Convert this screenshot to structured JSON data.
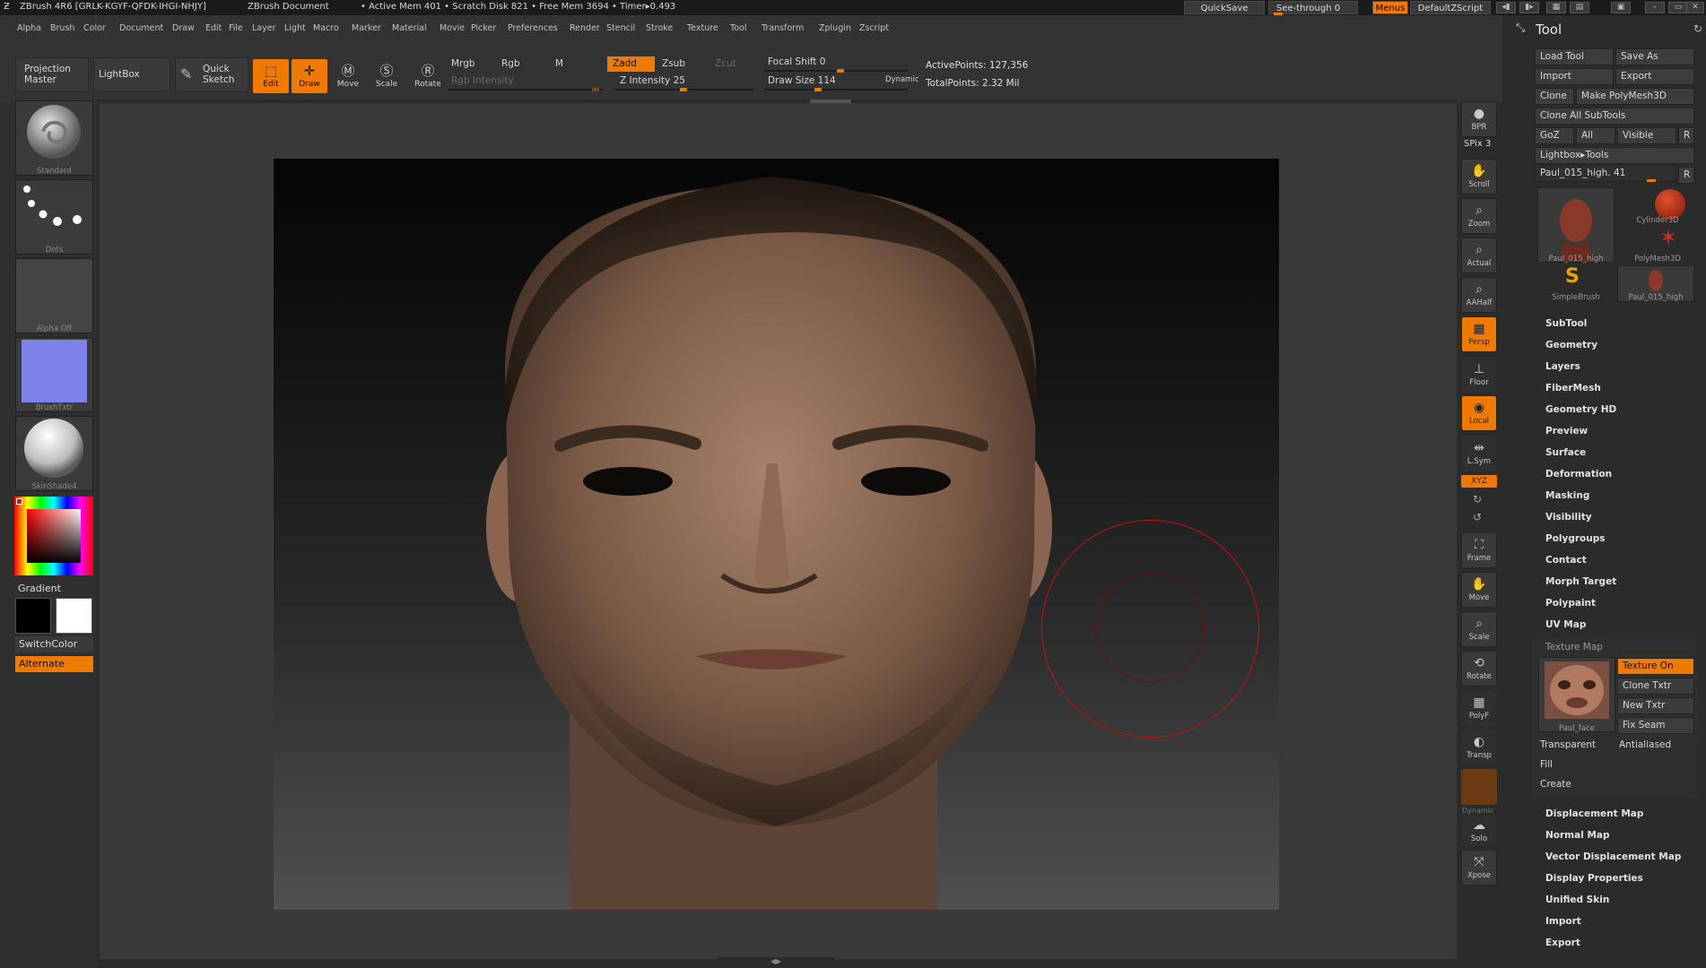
{
  "titlebar": {
    "app_title": "ZBrush 4R6 [GRLK-KGYF-QFDK-IHGI-NHJY]",
    "document": "ZBrush Document",
    "status": "• Active Mem 401 • Scratch Disk 821 • Free Mem 3694 • Timer▸0.493",
    "quicksave": "QuickSave",
    "see_through": "See-through  0",
    "menus": "Menus",
    "default_zscript": "DefaultZScript"
  },
  "menubar": [
    "Alpha",
    "Brush",
    "Color",
    "Document",
    "Draw",
    "Edit",
    "File",
    "Layer",
    "Light",
    "Macro",
    "Marker",
    "Material",
    "Movie",
    "Picker",
    "Preferences",
    "Render",
    "Stencil",
    "Stroke",
    "Texture",
    "Tool",
    "Transform",
    "Zplugin",
    "Zscript"
  ],
  "shelf": {
    "projection_master": "Projection Master",
    "lightbox": "LightBox",
    "quick_sketch": "Quick Sketch",
    "tools": [
      {
        "label": "Edit",
        "icon": "edit-icon",
        "active": true
      },
      {
        "label": "Draw",
        "icon": "draw-icon",
        "active": true
      },
      {
        "label": "Move",
        "icon": "move-icon",
        "active": false
      },
      {
        "label": "Scale",
        "icon": "scale-icon",
        "active": false
      },
      {
        "label": "Rotate",
        "icon": "rotate-icon",
        "active": false
      }
    ],
    "mrgb": "Mrgb",
    "rgb": "Rgb",
    "m": "M",
    "rgb_intensity": "Rgb Intensity",
    "zadd": "Zadd",
    "zsub": "Zsub",
    "zcut": "Zcut",
    "z_intensity": "Z Intensity 25",
    "focal_shift": "Focal Shift 0",
    "draw_size": "Draw Size 114",
    "dynamic": "Dynamic",
    "active_points": "ActivePoints: 127,356",
    "total_points": "TotalPoints: 2.32 Mil"
  },
  "lefttray": {
    "brush": "Standard",
    "stroke": "Dots",
    "alpha": "Alpha Off",
    "texture": "BrushTxtr",
    "material": "SkinShade4",
    "gradient": "Gradient",
    "switch_color": "SwitchColor",
    "alternate": "Alternate"
  },
  "righttool": [
    {
      "label": "BPR",
      "icon": "bpr-icon",
      "orange": false
    },
    {
      "label": "Scroll",
      "icon": "scroll-icon",
      "orange": false
    },
    {
      "label": "Zoom",
      "icon": "zoom-icon",
      "orange": false
    },
    {
      "label": "Actual",
      "icon": "actual-icon",
      "orange": false
    },
    {
      "label": "AAHalf",
      "icon": "aahalf-icon",
      "orange": false
    },
    {
      "label": "Persp",
      "icon": "persp-icon",
      "orange": true
    },
    {
      "label": "Floor",
      "icon": "floor-icon",
      "orange": false
    },
    {
      "label": "Local",
      "icon": "local-icon",
      "orange": true
    },
    {
      "label": "L.Sym",
      "icon": "lsym-icon",
      "orange": false
    },
    {
      "label": "Frame",
      "icon": "frame-icon",
      "orange": false
    },
    {
      "label": "Move",
      "icon": "move-icon",
      "orange": false
    },
    {
      "label": "Scale",
      "icon": "scale-icon",
      "orange": false
    },
    {
      "label": "Rotate",
      "icon": "rotate-icon",
      "orange": false
    },
    {
      "label": "PolyF",
      "icon": "polyf-icon",
      "orange": false
    },
    {
      "label": "Transp",
      "icon": "transp-icon",
      "orange": false
    },
    {
      "label": "Solo",
      "icon": "solo-icon",
      "orange": false
    },
    {
      "label": "Xpose",
      "icon": "xpose-icon",
      "orange": false
    }
  ],
  "righttool_misc": {
    "spix": "SPix 3",
    "xyz": "XYZ",
    "dynamic": "Dynamic"
  },
  "palette": {
    "title": "Tool",
    "load_tool": "Load Tool",
    "save_as": "Save As",
    "import": "Import",
    "export": "Export",
    "clone": "Clone",
    "make_polymesh": "Make PolyMesh3D",
    "clone_all": "Clone All SubTools",
    "goz": "GoZ",
    "all": "All",
    "visible": "Visible",
    "r": "R",
    "lightbox_tools": "Lightbox▸Tools",
    "current_tool": "Paul_015_high. 41",
    "thumbs": [
      "Paul_015_high",
      "Cylinder3D",
      "PolyMesh3D",
      "SimpleBrush",
      "Paul_015_high"
    ],
    "subpalettes_a": [
      "SubTool",
      "Geometry",
      "Layers",
      "FiberMesh",
      "Geometry HD",
      "Preview",
      "Surface",
      "Deformation",
      "Masking",
      "Visibility",
      "Polygroups",
      "Contact",
      "Morph Target",
      "Polypaint",
      "UV Map"
    ],
    "texture_map": {
      "title": "Texture Map",
      "texture_on": "Texture On",
      "clone_txtr": "Clone Txtr",
      "new_txtr": "New Txtr",
      "fix_seam": "Fix Seam",
      "thumb_label": "Paul_face",
      "transparent": "Transparent",
      "antialiased": "Antialiased",
      "fill": "Fill",
      "create": "Create"
    },
    "subpalettes_b": [
      "Displacement Map",
      "Normal Map",
      "Vector Displacement Map",
      "Display Properties",
      "Unified Skin",
      "Import",
      "Export"
    ]
  },
  "colors": {
    "accent": "#f07a00",
    "panel": "#2b2b2b",
    "canvas": "#3a3a3a"
  }
}
